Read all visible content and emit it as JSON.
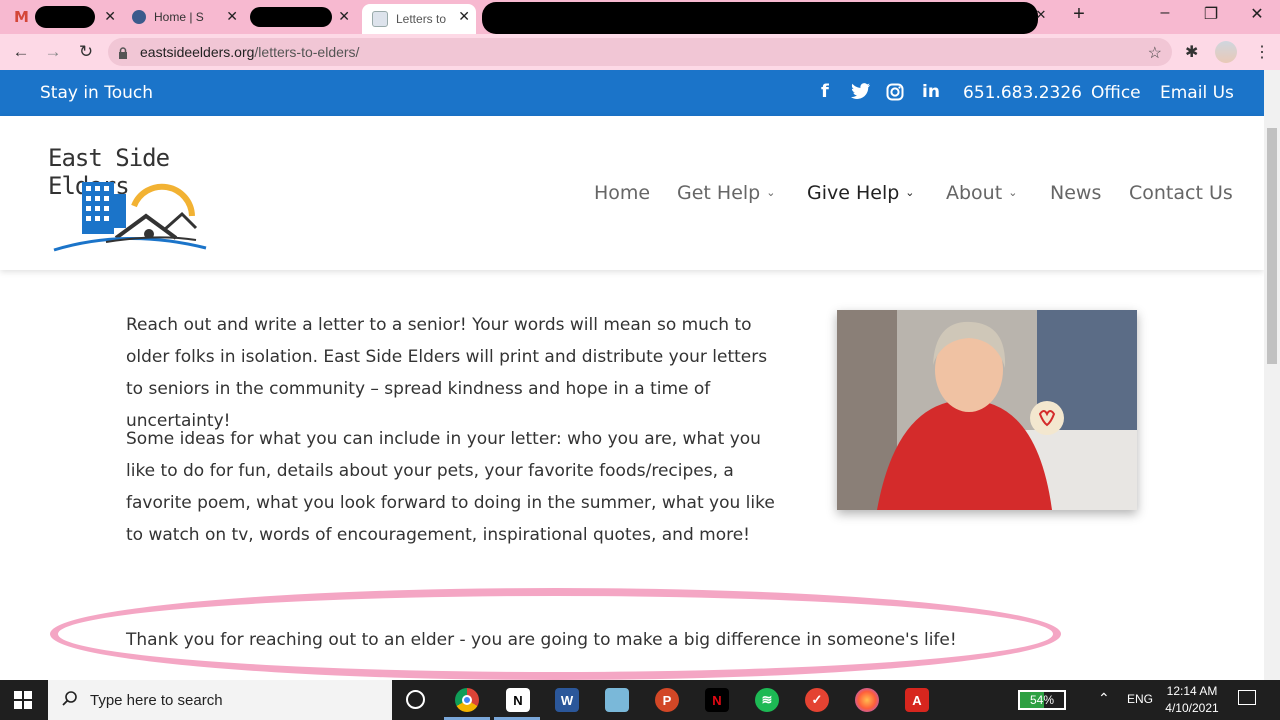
{
  "browser": {
    "tabs": [
      {
        "label": "",
        "redacted": true
      },
      {
        "label": "Home | S"
      },
      {
        "label": "",
        "redacted": true
      },
      {
        "label": "Letters to",
        "active": true
      },
      {
        "label": "",
        "redacted": true
      }
    ],
    "new_tab": "+",
    "url_host": "eastsideelders.org",
    "url_path": "/letters-to-elders/"
  },
  "site": {
    "topbar": {
      "stay_label": "Stay in Touch",
      "phone": "651.683.2326",
      "office": "Office",
      "email": "Email Us"
    },
    "logo_text": "East Side Elders",
    "nav": [
      {
        "label": "Home"
      },
      {
        "label": "Get Help"
      },
      {
        "label": "Give Help"
      },
      {
        "label": "About"
      },
      {
        "label": "News"
      },
      {
        "label": "Contact Us"
      }
    ],
    "body": {
      "para1": "Reach out and write a letter to a senior!  Your words will mean so much to older folks in isolation.  East Side Elders will print and distribute your letters to seniors in the community – spread kindness and hope in a time of uncertainty!",
      "para2": "Some ideas for what you can include in your letter:  who you are, what you like to do for fun, details about your pets, your favorite foods/recipes, a favorite poem, what you look forward to doing in the summer, what you like to watch on tv, words of encouragement, inspirational quotes, and more!",
      "thanks": "Thank you for reaching out to an elder - you are going to make a big difference in someone's life!"
    }
  },
  "taskbar": {
    "search_placeholder": "Type here to search",
    "battery": "54%",
    "battery_level": 0.54,
    "lang": "ENG",
    "time": "12:14 AM",
    "date": "4/10/2021"
  },
  "colors": {
    "brand_blue": "#1b74c9",
    "highlight_pink": "#f4a6c4",
    "browser_pink": "#f7b9d0"
  }
}
